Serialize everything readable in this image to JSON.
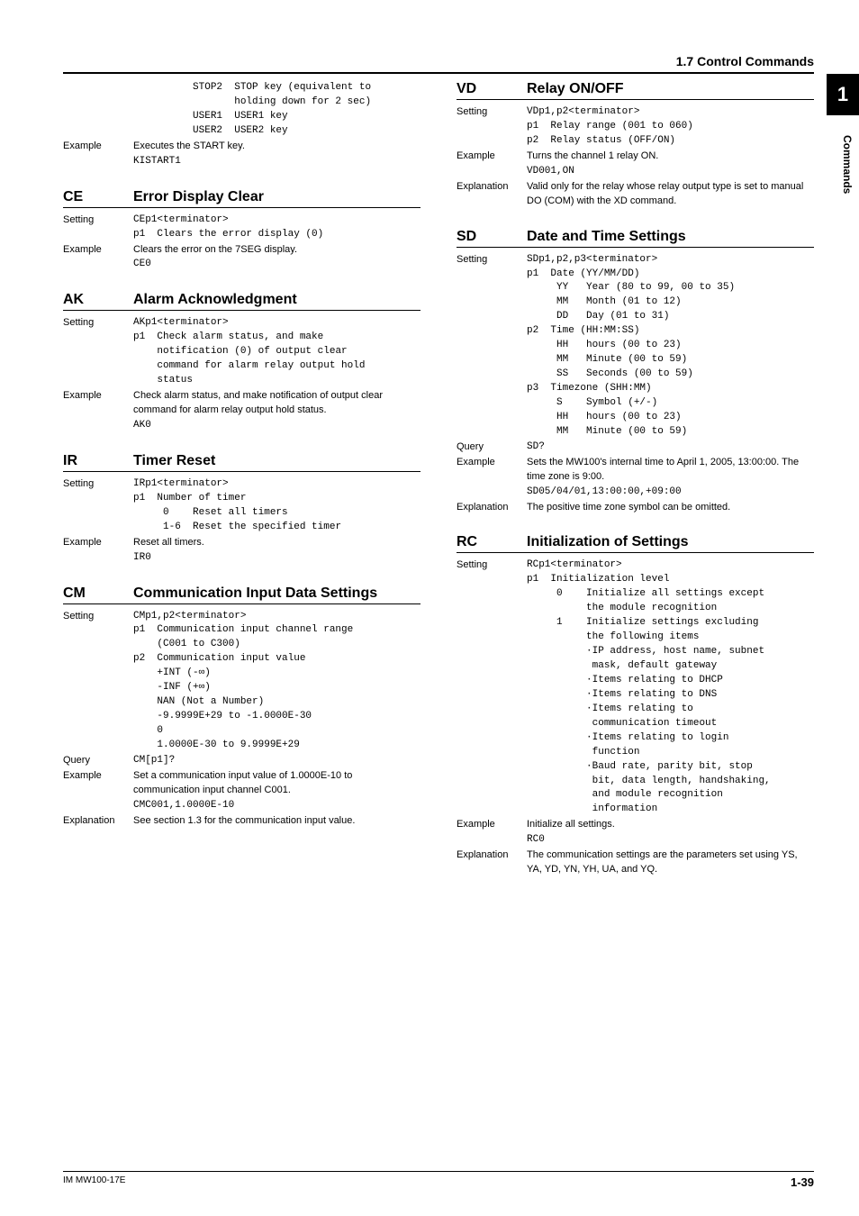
{
  "section_header": "1.7  Control Commands",
  "side_tab_num": "1",
  "side_label": "Commands",
  "footer_left": "IM MW100-17E",
  "footer_right": "1-39",
  "left": {
    "pre": {
      "setting": "          STOP2  STOP key (equivalent to\n                 holding down for 2 sec)\n          USER1  USER1 key\n          USER2  USER2 key",
      "ex_label": "Example",
      "ex_text": "Executes the START key.",
      "ex_code": "KISTART1"
    },
    "ce": {
      "code": "CE",
      "title": "Error Display Clear",
      "set_label": "Setting",
      "setting": "CEp1<terminator>\np1  Clears the error display (0)",
      "ex_label": "Example",
      "ex_text": "Clears the error on the 7SEG display.",
      "ex_code": "CE0"
    },
    "ak": {
      "code": "AK",
      "title": "Alarm Acknowledgment",
      "set_label": "Setting",
      "setting": "AKp1<terminator>\np1  Check alarm status, and make\n    notification (0) of output clear\n    command for alarm relay output hold\n    status",
      "ex_label": "Example",
      "ex_text": "Check alarm status, and make notification of output clear command for alarm relay output hold status.",
      "ex_code": "AK0"
    },
    "ir": {
      "code": "IR",
      "title": "Timer Reset",
      "set_label": "Setting",
      "setting": "IRp1<terminator>\np1  Number of timer\n     0    Reset all timers\n     1-6  Reset the specified timer",
      "ex_label": "Example",
      "ex_text": "Reset all timers.",
      "ex_code": "IR0"
    },
    "cm": {
      "code": "CM",
      "title": "Communication Input Data Settings",
      "set_label": "Setting",
      "setting": "CMp1,p2<terminator>\np1  Communication input channel range\n    (C001 to C300)\np2  Communication input value\n    +INT (-∞)\n    -INF (+∞)\n    NAN (Not a Number)\n    -9.9999E+29 to -1.0000E-30\n    0\n    1.0000E-30 to 9.9999E+29",
      "q_label": "Query",
      "q_text": "CM[p1]?",
      "ex_label": "Example",
      "ex_text": "Set a communication input value of 1.0000E-10 to communication input channel C001.",
      "ex_code": "CMC001,1.0000E-10",
      "exp_label": "Explanation",
      "exp_text": "See section 1.3 for the communication input value."
    }
  },
  "right": {
    "vd": {
      "code": "VD",
      "title": "Relay ON/OFF",
      "set_label": "Setting",
      "setting": "VDp1,p2<terminator>\np1  Relay range (001 to 060)\np2  Relay status (OFF/ON)",
      "ex_label": "Example",
      "ex_text": "Turns the channel 1 relay ON.",
      "ex_code": "VD001,ON",
      "exp_label": "Explanation",
      "exp_text": "Valid only for the relay whose relay output type is set to manual DO (COM) with the XD command."
    },
    "sd": {
      "code": "SD",
      "title": "Date and Time Settings",
      "set_label": "Setting",
      "setting": "SDp1,p2,p3<terminator>\np1  Date (YY/MM/DD)\n     YY   Year (80 to 99, 00 to 35)\n     MM   Month (01 to 12)\n     DD   Day (01 to 31)\np2  Time (HH:MM:SS)\n     HH   hours (00 to 23)\n     MM   Minute (00 to 59)\n     SS   Seconds (00 to 59)\np3  Timezone (SHH:MM)\n     S    Symbol (+/-)\n     HH   hours (00 to 23)\n     MM   Minute (00 to 59)",
      "q_label": "Query",
      "q_text": "SD?",
      "ex_label": "Example",
      "ex_text": "Sets the MW100's internal time to April 1, 2005, 13:00:00. The time zone is 9:00.",
      "ex_code": "SD05/04/01,13:00:00,+09:00",
      "exp_label": "Explanation",
      "exp_text": "The positive time zone symbol can be omitted."
    },
    "rc": {
      "code": "RC",
      "title": "Initialization of Settings",
      "set_label": "Setting",
      "setting": "RCp1<terminator>\np1  Initialization level\n     0    Initialize all settings except\n          the module recognition\n     1    Initialize settings excluding\n          the following items\n          ·IP address, host name, subnet\n           mask, default gateway\n          ·Items relating to DHCP\n          ·Items relating to DNS\n          ·Items relating to\n           communication timeout\n          ·Items relating to login\n           function\n          ·Baud rate, parity bit, stop\n           bit, data length, handshaking,\n           and module recognition\n           information",
      "ex_label": "Example",
      "ex_text": "Initialize all settings.",
      "ex_code": "RC0",
      "exp_label": "Explanation",
      "exp_text": "The communication settings are the parameters set using YS, YA, YD, YN, YH, UA, and YQ."
    }
  }
}
